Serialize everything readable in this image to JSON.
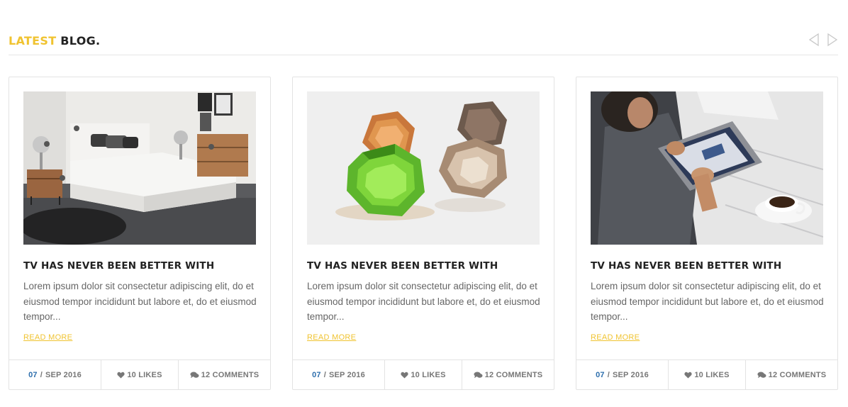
{
  "header": {
    "title_accent": "LATEST",
    "title_main": "BLOG.",
    "prev_icon": "triangle-left-outline",
    "next_icon": "triangle-right-outline"
  },
  "colors": {
    "accent": "#f0c330",
    "date_day": "#2e6fad",
    "text": "#666666",
    "heading": "#222222",
    "border": "#e3e3e3"
  },
  "posts": [
    {
      "image": "bedroom-photo",
      "title": "TV HAS NEVER BEEN BETTER WITH",
      "excerpt": "Lorem ipsum dolor sit consectetur adipiscing elit, do et eiusmod tempor incididunt but labore et, do et eiusmod tempor...",
      "read_more": "READ MORE",
      "date_day": "07",
      "date_rest": "SEP 2016",
      "likes": "10 LIKES",
      "comments": "12 COMMENTS",
      "likes_icon": "heart-icon",
      "comments_icon": "comments-icon"
    },
    {
      "image": "dodecahedron-calendars-photo",
      "title": "TV HAS NEVER BEEN BETTER WITH",
      "excerpt": "Lorem ipsum dolor sit consectetur adipiscing elit, do et eiusmod tempor incididunt but labore et, do et eiusmod tempor...",
      "read_more": "READ MORE",
      "date_day": "07",
      "date_rest": "SEP 2016",
      "likes": "10 LIKES",
      "comments": "12 COMMENTS",
      "likes_icon": "heart-icon",
      "comments_icon": "comments-icon"
    },
    {
      "image": "tablet-coffee-photo",
      "title": "TV HAS NEVER BEEN BETTER WITH",
      "excerpt": "Lorem ipsum dolor sit consectetur adipiscing elit, do et eiusmod tempor incididunt but labore et, do et eiusmod tempor...",
      "read_more": "READ MORE",
      "date_day": "07",
      "date_rest": "SEP 2016",
      "likes": "10 LIKES",
      "comments": "12 COMMENTS",
      "likes_icon": "heart-icon",
      "comments_icon": "comments-icon"
    }
  ]
}
